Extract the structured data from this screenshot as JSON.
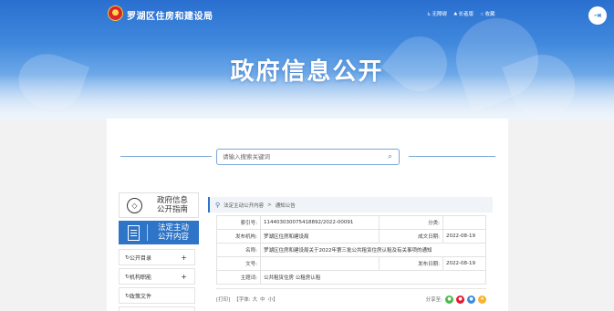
{
  "header": {
    "site_name": "罗湖区住房和建设局",
    "links": [
      {
        "icon": "accessibility-icon",
        "glyph": "♿",
        "label": "无障碍"
      },
      {
        "icon": "elder-icon",
        "glyph": "♣",
        "label": "长者版"
      },
      {
        "icon": "star-icon",
        "glyph": "☆",
        "label": "收藏"
      }
    ],
    "exit_glyph": "⇥"
  },
  "hero": {
    "title": "政府信息公开"
  },
  "search": {
    "placeholder": "请输入搜索关键词",
    "icon_glyph": "⌕"
  },
  "sidebar": {
    "guide": {
      "line1": "政府信息",
      "line2": "公开指南",
      "icon_glyph": "◇"
    },
    "active": {
      "line1": "法定主动",
      "line2": "公开内容"
    },
    "items": [
      {
        "label": "公开目录",
        "icon": "↻",
        "expand": "+"
      },
      {
        "label": "机构职能",
        "icon": "↻",
        "expand": "+"
      },
      {
        "label": "政策文件",
        "icon": "↻",
        "expand": ""
      }
    ]
  },
  "breadcrumb": {
    "pin_glyph": "⬤",
    "items": [
      "法定主动公开内容",
      "通知公告"
    ],
    "separator": ">"
  },
  "info": {
    "index_label": "索引号:",
    "index_value": "11440303007541889​2/2022-00091",
    "category_label": "分类:",
    "category_value": "",
    "publisher_label": "发布机构:",
    "publisher_value": "罗湖区住房和建设局",
    "created_label": "成文日期:",
    "created_value": "2022-08-19",
    "name_label": "名称:",
    "name_value": "罗湖区住房和建设局关于2022年第三批公共租赁住房认租及有关事项的通知",
    "docno_label": "文号:",
    "docno_value": "",
    "pubdate_label": "发布日期:",
    "pubdate_value": "2022-08-19",
    "subject_label": "主题词:",
    "subject_value": "公共租赁住房 公租房认租"
  },
  "toolbar": {
    "print": "[打印]",
    "font_label": "【字体:",
    "font_large": "大",
    "font_mid": "中",
    "font_small": "小】",
    "share_label": "分享至:"
  },
  "colors": {
    "accent": "#2e74c7",
    "wechat": "#4cb848",
    "weibo": "#e6162d",
    "qq": "#3a8bdc",
    "qzone": "#f7b32b"
  }
}
